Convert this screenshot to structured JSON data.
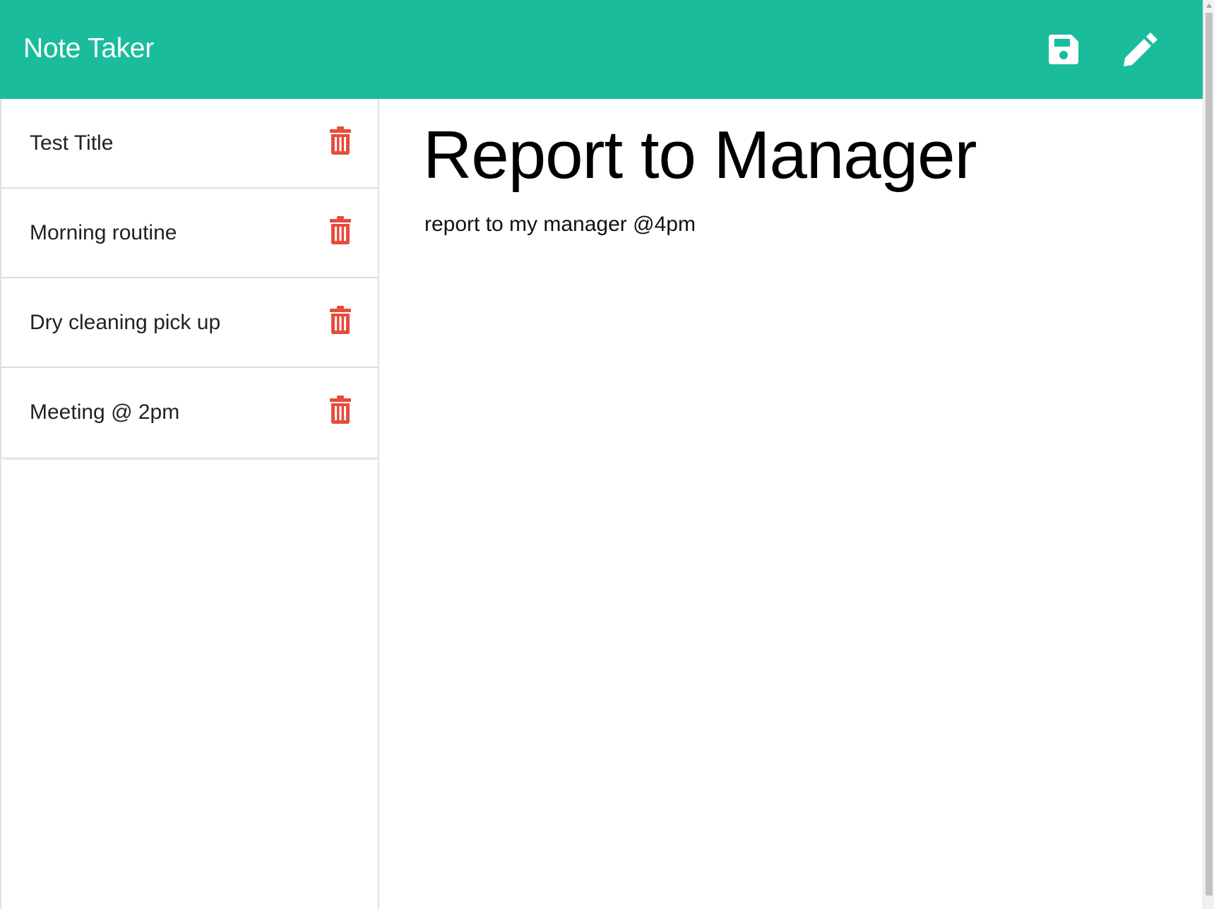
{
  "header": {
    "brand": "Note Taker",
    "save_icon": "floppy-disk-icon",
    "new_note_icon": "pencil-icon",
    "icon_color": "#ffffff",
    "background_color": "#1abc9c"
  },
  "sidebar": {
    "notes": [
      {
        "title": "Test Title",
        "delete_icon": "trash-icon"
      },
      {
        "title": "Morning routine",
        "delete_icon": "trash-icon"
      },
      {
        "title": "Dry cleaning pick up",
        "delete_icon": "trash-icon"
      },
      {
        "title": "Meeting @ 2pm",
        "delete_icon": "trash-icon"
      }
    ],
    "delete_color": "#e74c3c"
  },
  "editor": {
    "title": "Report to Manager",
    "text": "report to my manager @4pm"
  }
}
